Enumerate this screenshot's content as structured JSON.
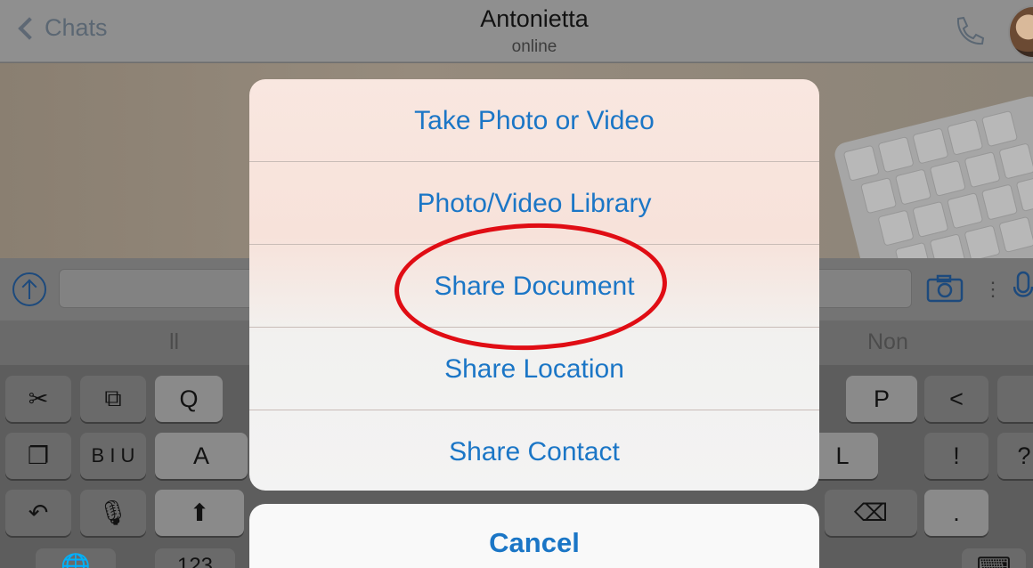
{
  "navbar": {
    "back_label": "Chats",
    "contact_name": "Antonietta",
    "contact_status": "online",
    "icons": {
      "back": "chevron-left-icon",
      "call": "phone-icon",
      "avatar": "avatar"
    }
  },
  "input_bar": {
    "icons": [
      "upload-arrow-icon",
      "camera-icon",
      "more-dots-icon",
      "microphone-icon"
    ]
  },
  "keyboard": {
    "suggestions": [
      "ll",
      "Non"
    ],
    "rows": [
      {
        "keys": [
          "Q",
          "P",
          "<"
        ]
      },
      {
        "keys": [
          "A",
          "L",
          "!",
          "?"
        ]
      },
      {
        "keys": [
          "B I U",
          "."
        ]
      },
      {
        "keys": [
          "123"
        ]
      }
    ]
  },
  "action_sheet": {
    "items": [
      {
        "label": "Take Photo or Video"
      },
      {
        "label": "Photo/Video Library"
      },
      {
        "label": "Share Document",
        "highlighted": true
      },
      {
        "label": "Share Location"
      },
      {
        "label": "Share Contact"
      }
    ],
    "cancel_label": "Cancel",
    "accent_color": "#1b76c6",
    "highlight_color": "#e00d14"
  }
}
